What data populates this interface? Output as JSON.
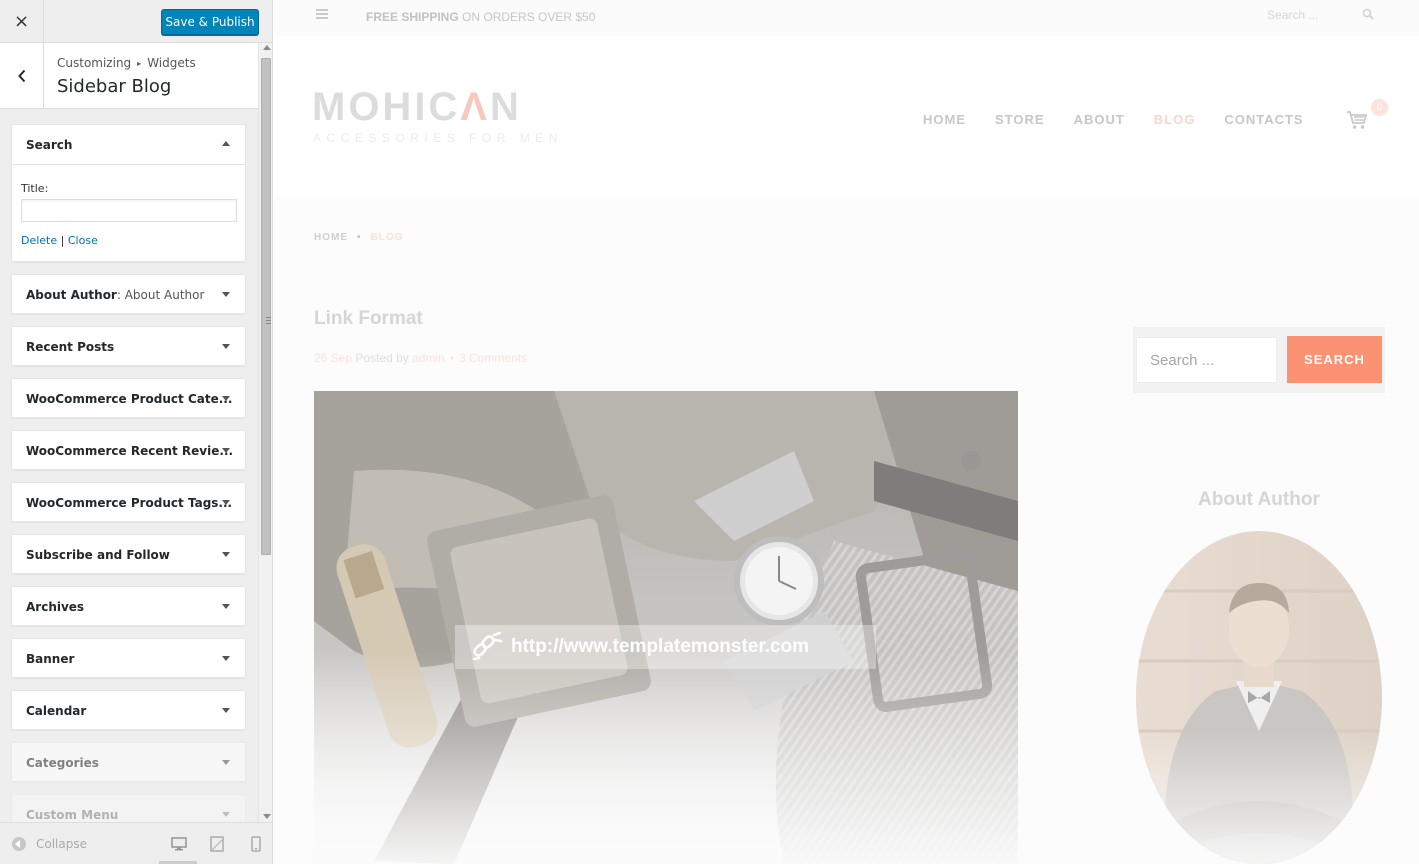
{
  "customizer": {
    "close_label": "×",
    "publish_label": "Save & Publish",
    "breadcrumb": {
      "root": "Customizing",
      "separator": "▸",
      "section": "Widgets"
    },
    "section_title": "Sidebar Blog",
    "open_widget": {
      "title": "Search",
      "field_label": "Title:",
      "field_value": "",
      "delete_label": "Delete",
      "divider": "|",
      "close_label": "Close"
    },
    "widgets": [
      {
        "title": "About Author",
        "subtitle": ": About Author"
      },
      {
        "title": "Recent Posts",
        "subtitle": ""
      },
      {
        "title": "WooCommerce Product Cate...",
        "subtitle": ""
      },
      {
        "title": "WooCommerce Recent Revie...",
        "subtitle": ""
      },
      {
        "title": "WooCommerce Product Tags...",
        "subtitle": ""
      },
      {
        "title": "Subscribe and Follow",
        "subtitle": ""
      },
      {
        "title": "Archives",
        "subtitle": ""
      },
      {
        "title": "Banner",
        "subtitle": ""
      },
      {
        "title": "Calendar",
        "subtitle": ""
      },
      {
        "title": "Categories",
        "subtitle": ""
      },
      {
        "title": "Custom Menu",
        "subtitle": ""
      }
    ],
    "collapse_label": "Collapse",
    "devices": [
      "desktop-icon",
      "tablet-icon",
      "mobile-icon"
    ]
  },
  "preview": {
    "topbar": {
      "shipping_bold": "FREE SHIPPING",
      "shipping_rest": " ON ORDERS OVER $50",
      "search_placeholder": "Search ..."
    },
    "logo": {
      "part1": "MOHIC",
      "accent": "Λ",
      "part2": "N",
      "tagline": "ACCESSORIES FOR MEN"
    },
    "nav": [
      "HOME",
      "STORE",
      "ABOUT",
      "BLOG",
      "CONTACTS"
    ],
    "nav_active_index": 3,
    "cart_count": "0",
    "breadcrumbs": {
      "home": "HOME",
      "separator": "•",
      "current": "BLOG"
    },
    "post": {
      "title": "Link Format",
      "date": "26 Sep",
      "posted_by": "Posted by",
      "author": "admin",
      "separator": "•",
      "comments": "3 Comments",
      "link_url": "http://www.templatemonster.com"
    },
    "sidebar": {
      "search_placeholder": "Search ...",
      "search_button": "SEARCH",
      "about_title": "About Author"
    }
  },
  "colors": {
    "accent": "#fb9273",
    "wp_blue": "#0085ba",
    "wp_link": "#0073aa"
  }
}
